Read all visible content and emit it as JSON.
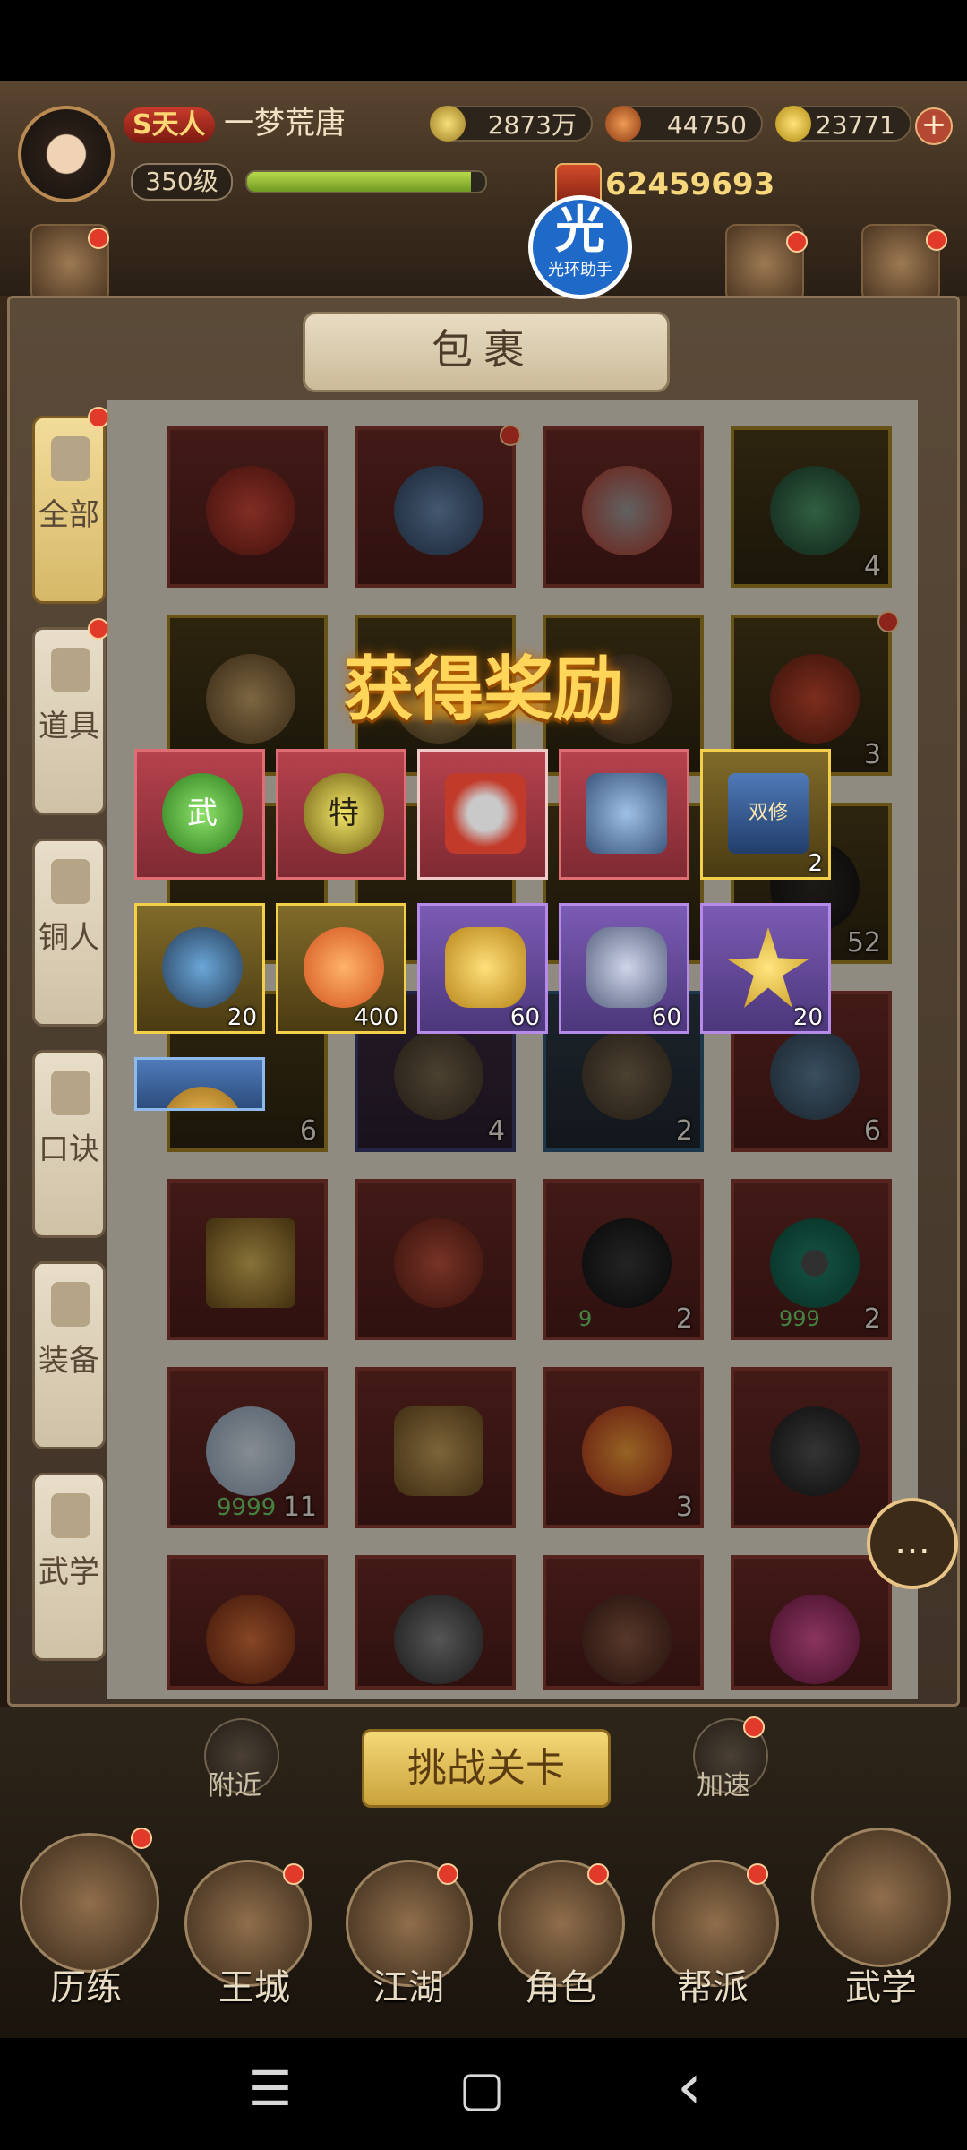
{
  "header": {
    "vip_label": "S天人",
    "player_name": "一梦荒唐",
    "level": "350级",
    "xp_fraction": 0.94,
    "copper": "2873万",
    "jade": "44750",
    "gold": "23771",
    "plus_label": "+",
    "power": "62459693"
  },
  "halo": {
    "glyph": "光",
    "caption": "光环助手"
  },
  "panel": {
    "title": "包裹"
  },
  "tabs": [
    {
      "label": "全部",
      "active": true
    },
    {
      "label": "道具"
    },
    {
      "label": "铜人"
    },
    {
      "label": "口诀"
    },
    {
      "label": "装备"
    },
    {
      "label": "武学"
    }
  ],
  "inventory": {
    "row1": [
      "",
      "",
      "",
      "4"
    ],
    "row2": [
      "",
      "",
      "",
      "3"
    ],
    "row3": [
      "",
      "",
      "",
      "52"
    ],
    "row4": [
      "6",
      "4",
      "2",
      "6"
    ],
    "row5": [
      "",
      "",
      "2",
      "2"
    ],
    "row5_sub": [
      "",
      "",
      "9",
      "999"
    ],
    "row6": [
      "11",
      "",
      "3",
      ""
    ],
    "row6_sub": [
      "9999"
    ]
  },
  "reward": {
    "title": "获得奖励",
    "row1": [
      {
        "count": "",
        "icon": "green-gem-icon",
        "glyph": "武"
      },
      {
        "count": "",
        "icon": "yellow-gem-icon",
        "glyph": "特"
      },
      {
        "count": "",
        "icon": "weapon-chest-icon"
      },
      {
        "count": "",
        "icon": "book-chest-icon"
      },
      {
        "count": "2",
        "icon": "book-icon",
        "glyph": "双修"
      }
    ],
    "row2": [
      {
        "count": "20",
        "icon": "potion-pouch-icon"
      },
      {
        "count": "400",
        "icon": "orange-medal-icon"
      },
      {
        "count": "60",
        "icon": "gold-ore-icon"
      },
      {
        "count": "60",
        "icon": "silver-ore-icon"
      },
      {
        "count": "20",
        "icon": "gold-crystal-icon"
      }
    ]
  },
  "bottom": {
    "challenge": "挑战关卡",
    "nearby": "附近",
    "speedup": "加速",
    "nav": [
      "历练",
      "王城",
      "江湖",
      "角色",
      "帮派",
      "武学"
    ]
  },
  "android": {
    "menu": "☰",
    "home": "▢",
    "back": "‹"
  },
  "colors": {
    "accent": "#f4d04a",
    "red_dot": "#e23a2a",
    "halo_blue": "#1f69c9"
  }
}
